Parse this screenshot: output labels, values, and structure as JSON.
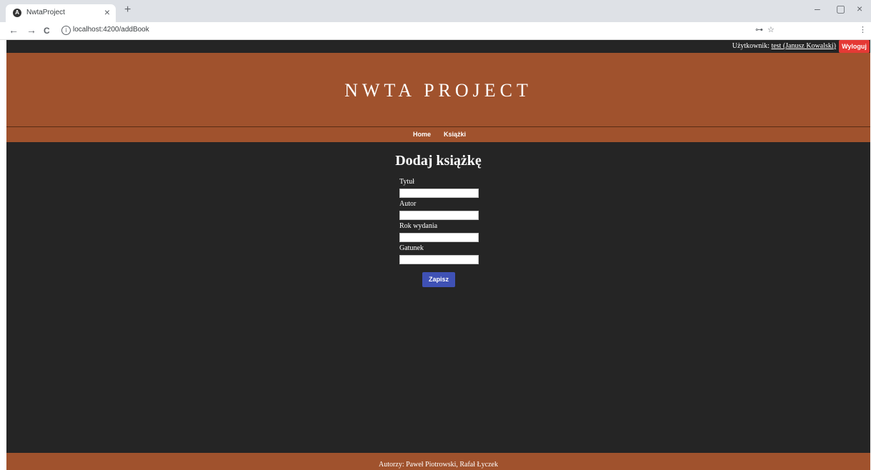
{
  "browser": {
    "tab_title": "NwtaProject",
    "tab_favicon": "angular-icon",
    "tab_close": "×",
    "new_tab": "+",
    "url": "localhost:4200/addBook",
    "back": "←",
    "forward": "→",
    "reload": "C",
    "info": "i",
    "key_icon": "⊶",
    "star_icon": "☆",
    "menu_icon": "⋮",
    "minimize": "–",
    "maximize": "▢",
    "close": "×"
  },
  "userbar": {
    "label": "Użytkownik:",
    "username": "test (Janusz Kowalski)",
    "logout_label": "Wyloguj"
  },
  "header": {
    "title": "NWTA PROJECT"
  },
  "nav": {
    "home": "Home",
    "books": "Książki"
  },
  "form": {
    "title": "Dodaj książkę",
    "fields": [
      {
        "label": "Tytuł",
        "value": ""
      },
      {
        "label": "Autor",
        "value": ""
      },
      {
        "label": "Rok wydania",
        "value": ""
      },
      {
        "label": "Gatunek",
        "value": ""
      }
    ],
    "submit_label": "Zapisz"
  },
  "footer": {
    "text": "Autorzy: Paweł Piotrowski, Rafał Łyczek"
  },
  "colors": {
    "header_bg": "#a0522d",
    "page_bg": "#252525",
    "logout_bg": "#e53935",
    "submit_bg": "#3f51b5"
  }
}
